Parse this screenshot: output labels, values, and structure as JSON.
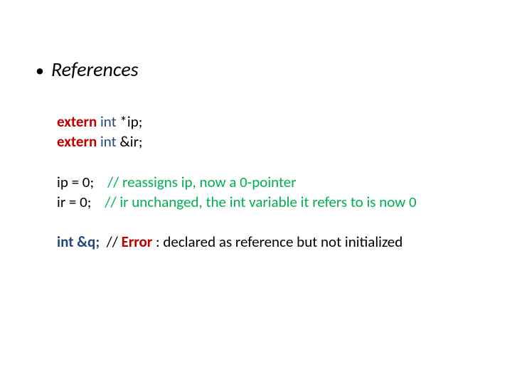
{
  "heading": "References",
  "code": {
    "l1": {
      "kw": "extern",
      "type": " int ",
      "rest": "*ip;"
    },
    "l2": {
      "kw": "extern",
      "type": " int ",
      "rest": "&ir;"
    },
    "l3": {
      "stmt": "ip = 0;    ",
      "cm": "// reassigns ip, now a 0-pointer"
    },
    "l4": {
      "stmt": "ir = 0;    ",
      "cm": "// ir unchanged, the int variable it refers to is now 0"
    },
    "l5": {
      "decl": "int &q;",
      "sep": "  // ",
      "err": "Error",
      "rest": " : declared as reference but not initialized"
    }
  }
}
